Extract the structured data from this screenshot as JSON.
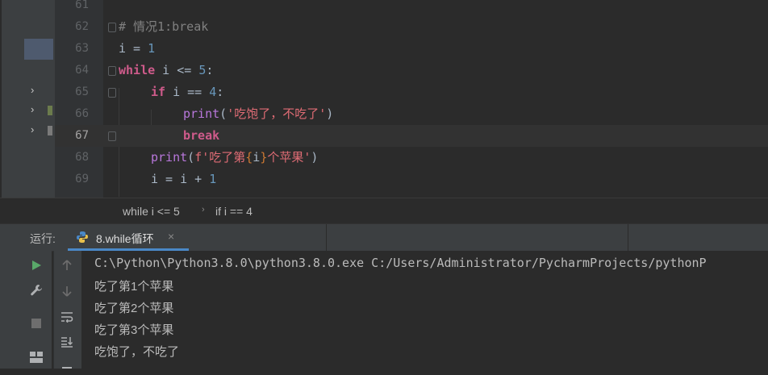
{
  "editor": {
    "lines": [
      {
        "num": "61"
      },
      {
        "num": "62"
      },
      {
        "num": "63"
      },
      {
        "num": "64"
      },
      {
        "num": "65"
      },
      {
        "num": "66"
      },
      {
        "num": "67"
      },
      {
        "num": "68"
      },
      {
        "num": "69"
      }
    ],
    "code": {
      "comment": "# 情况1:break",
      "l63_var": "i",
      "l63_op": " = ",
      "l63_num": "1",
      "l64_kw": "while",
      "l64_rest": " i <= ",
      "l64_num": "5",
      "l64_colon": ":",
      "l65_kw": "if",
      "l65_rest": " i == ",
      "l65_num": "4",
      "l65_colon": ":",
      "l66_fn": "print",
      "l66_open": "(",
      "l66_str": "'吃饱了，不吃了'",
      "l66_close": ")",
      "l67_kw": "break",
      "l68_fn": "print",
      "l68_open": "(",
      "l68_fprefix": "f",
      "l68_str1": "'吃了第",
      "l68_brace_open": "{",
      "l68_var": "i",
      "l68_brace_close": "}",
      "l68_str2": "个苹果'",
      "l68_close": ")",
      "l69_rest": "i = i + ",
      "l69_num": "1"
    }
  },
  "breadcrumb": {
    "item1": "while i <= 5",
    "sep": "›",
    "item2": "if i == 4"
  },
  "run_panel": {
    "label": "运行:",
    "tab_label": "8.while循环",
    "tab_close": "×"
  },
  "console": {
    "lines": [
      "C:\\Python\\Python3.8.0\\python3.8.0.exe C:/Users/Administrator/PycharmProjects/pythonP",
      "吃了第1个苹果",
      "吃了第2个苹果",
      "吃了第3个苹果",
      "吃饱了，不吃了"
    ]
  },
  "icons": {
    "run": "run-icon",
    "wrench": "wrench-icon",
    "stop": "stop-icon",
    "layout": "layout-icon",
    "up": "arrow-up-icon",
    "down": "arrow-down-icon",
    "wrap": "soft-wrap-icon",
    "scroll_end": "scroll-to-end-icon"
  },
  "colors": {
    "background": "#2b2b2b",
    "keyword": "#cc7832",
    "number": "#6897bb",
    "function": "#b877db",
    "run_green": "#59a869",
    "tab_underline": "#4a88c7"
  }
}
